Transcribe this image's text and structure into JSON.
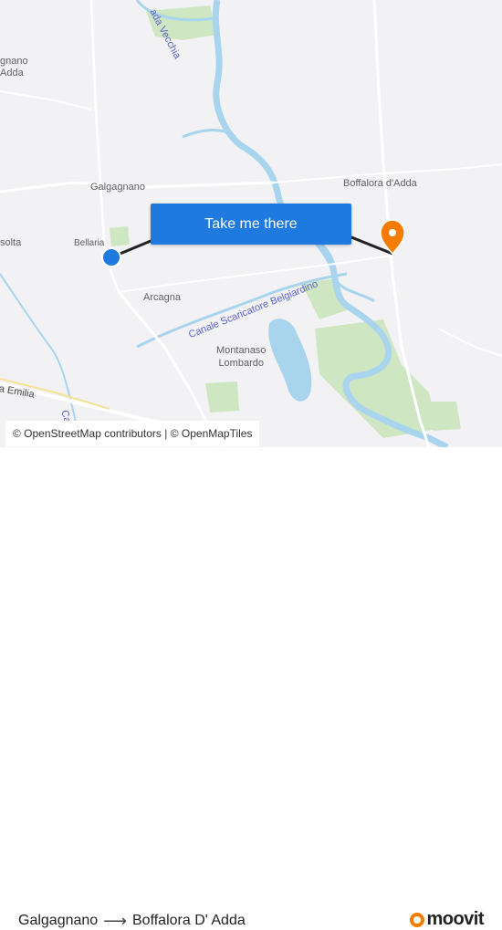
{
  "map": {
    "places": {
      "cignano": "gnano\nAdda",
      "galgagnano": "Galgagnano",
      "boffalora": "Boffalora d'Adda",
      "bellaria": "Bellaria",
      "soltarico": "solta",
      "arcagna": "Arcagna",
      "montanaso": "Montanaso\nLombardo",
      "via_emilia": "a Emilia"
    },
    "waterways": {
      "adda_vecchia": "ada Vecchia",
      "canale": "Canale Scaricatore Belgiardino",
      "canale_small": "Ca"
    },
    "colors": {
      "water": "#a8d4ee",
      "park": "#cfe6c3",
      "route": "#222222",
      "origin_marker": "#1f7adf",
      "destination_marker": "#f57c00",
      "cta_bg": "#1f7adf"
    }
  },
  "cta": {
    "label": "Take me there"
  },
  "attribution": "© OpenStreetMap contributors | © OpenMapTiles",
  "footer": {
    "origin": "Galgagnano",
    "destination": "Boffalora D' Adda",
    "brand": "moovit"
  }
}
